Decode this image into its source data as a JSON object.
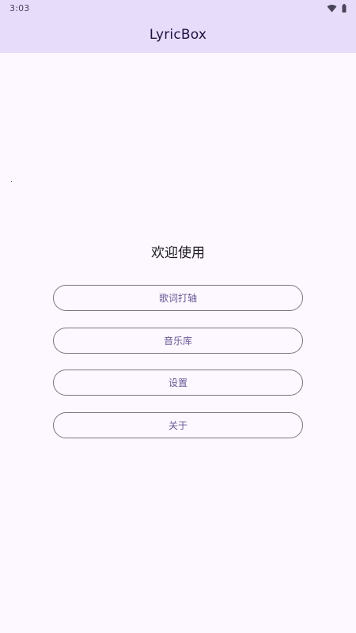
{
  "status_bar": {
    "time": "3:03",
    "wifi_icon": "wifi-icon",
    "battery_icon": "battery-icon"
  },
  "app_bar": {
    "title": "LyricBox"
  },
  "main": {
    "welcome": "欢迎使用",
    "buttons": [
      {
        "label": "歌词打轴"
      },
      {
        "label": "音乐库"
      },
      {
        "label": "设置"
      },
      {
        "label": "关于"
      }
    ]
  },
  "colors": {
    "app_bar_bg": "#e8dcfb",
    "page_bg": "#fdf7ff",
    "button_text": "#6a5a96",
    "button_border": "#7a7581"
  }
}
